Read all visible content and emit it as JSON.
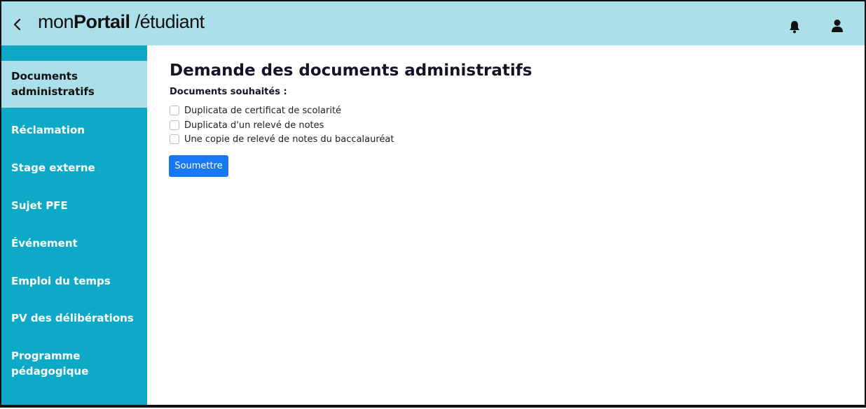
{
  "header": {
    "brand_prefix": "mon",
    "brand_bold": "Portail",
    "brand_suffix": " /étudiant",
    "background": "#abe0ea"
  },
  "sidebar": {
    "background": "#0fa9c8",
    "items": [
      {
        "label": "Documents administratifs",
        "active": true
      },
      {
        "label": "Réclamation"
      },
      {
        "label": "Stage externe"
      },
      {
        "label": "Sujet PFE"
      },
      {
        "label": "Événement"
      },
      {
        "label": "Emploi du temps"
      },
      {
        "label": "PV des délibérations"
      },
      {
        "label": "Programme pédagogique"
      }
    ]
  },
  "main": {
    "title": "Demande des documents administratifs",
    "label": "Documents souhaités :",
    "options": [
      {
        "label": "Duplicata de certificat de scolarité",
        "checked": false
      },
      {
        "label": "Duplicata d'un relevé de notes",
        "checked": false
      },
      {
        "label": "Une copie de relevé de notes du baccalauréat",
        "checked": false
      }
    ],
    "submit_label": "Soumettre",
    "submit_color": "#1877f2"
  },
  "icons": [
    "back-chevron-icon",
    "bell-icon",
    "user-icon"
  ]
}
